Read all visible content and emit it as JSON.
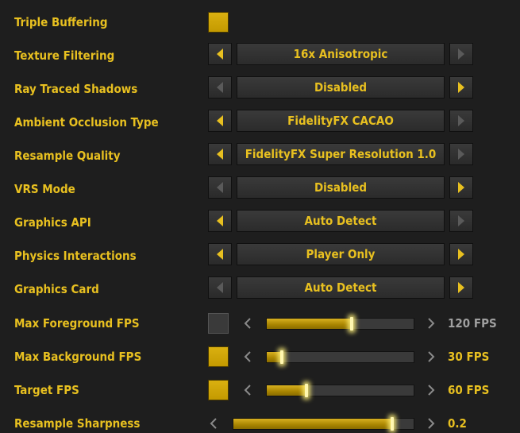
{
  "colors": {
    "accent": "#e8c020",
    "accent_fill": "#c49a00",
    "background": "#1e1e1e",
    "button_bg": "#333333",
    "disabled_text": "#a0a0a0",
    "arrow_disabled": "#5a5a5a"
  },
  "checkbox_rows": [
    {
      "label": "Triple Buffering",
      "checked": true
    }
  ],
  "selector_rows": [
    {
      "label": "Texture Filtering",
      "value": "16x Anisotropic",
      "prev_enabled": true,
      "next_enabled": false
    },
    {
      "label": "Ray Traced Shadows",
      "value": "Disabled",
      "prev_enabled": false,
      "next_enabled": true
    },
    {
      "label": "Ambient Occlusion Type",
      "value": "FidelityFX CACAO",
      "prev_enabled": true,
      "next_enabled": false
    },
    {
      "label": "Resample Quality",
      "value": "FidelityFX Super Resolution 1.0",
      "prev_enabled": true,
      "next_enabled": false
    },
    {
      "label": "VRS Mode",
      "value": "Disabled",
      "prev_enabled": false,
      "next_enabled": true
    },
    {
      "label": "Graphics API",
      "value": "Auto Detect",
      "prev_enabled": true,
      "next_enabled": false
    },
    {
      "label": "Physics Interactions",
      "value": "Player Only",
      "prev_enabled": true,
      "next_enabled": true
    },
    {
      "label": "Graphics Card",
      "value": "Auto Detect",
      "prev_enabled": false,
      "next_enabled": true
    }
  ],
  "slider_rows": [
    {
      "label": "Max Foreground FPS",
      "has_checkbox": true,
      "checked": false,
      "fraction": 0.58,
      "value_text": "120 FPS",
      "active": false
    },
    {
      "label": "Max Background FPS",
      "has_checkbox": true,
      "checked": true,
      "fraction": 0.1,
      "value_text": "30 FPS",
      "active": true
    },
    {
      "label": "Target FPS",
      "has_checkbox": true,
      "checked": true,
      "fraction": 0.27,
      "value_text": "60 FPS",
      "active": true
    },
    {
      "label": "Resample Sharpness",
      "has_checkbox": false,
      "checked": false,
      "fraction": 0.88,
      "value_text": "0.2",
      "active": true
    }
  ]
}
